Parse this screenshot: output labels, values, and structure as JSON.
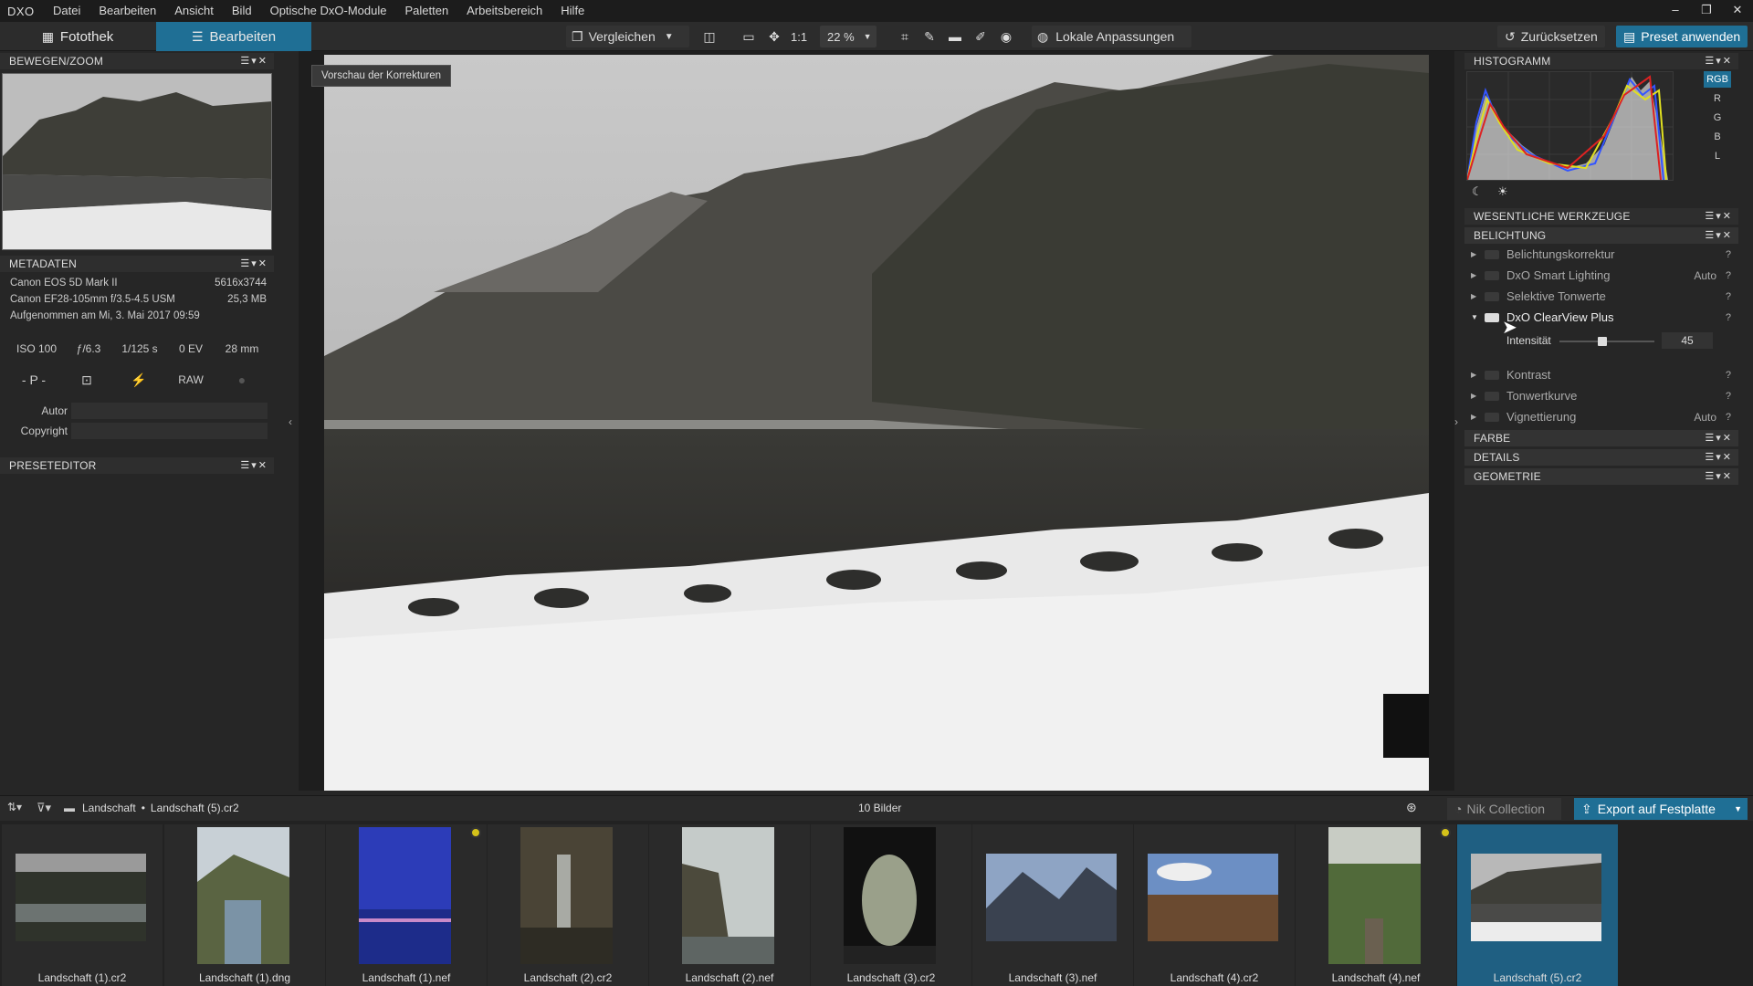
{
  "menubar": {
    "logo": "DXO",
    "items": [
      "Datei",
      "Bearbeiten",
      "Ansicht",
      "Bild",
      "Optische DxO-Module",
      "Paletten",
      "Arbeitsbereich",
      "Hilfe"
    ],
    "win_min": "–",
    "win_max": "❐",
    "win_close": "✕"
  },
  "toolbar": {
    "mode_library": "Fotothek",
    "mode_edit": "Bearbeiten",
    "compare": "Vergleichen",
    "one_to_one": "1:1",
    "zoom": "22 %",
    "local": "Lokale Anpassungen",
    "reset": "Zurücksetzen",
    "preset": "Preset anwenden"
  },
  "left": {
    "move_zoom_title": "BEWEGEN/ZOOM",
    "metadata_title": "METADATEN",
    "camera": "Canon EOS 5D Mark II",
    "resolution": "5616x3744",
    "lens": "Canon EF28-105mm f/3.5-4.5 USM",
    "filesize": "25,3 MB",
    "taken": "Aufgenommen am Mi, 3. Mai 2017 09:59",
    "iso": "ISO 100",
    "aperture": "ƒ/6.3",
    "shutter": "1/125 s",
    "ev": "0 EV",
    "focal": "28 mm",
    "mode": "- P -",
    "raw": "RAW",
    "author_label": "Autor",
    "copyright_label": "Copyright",
    "preset_title": "PRESETEDITOR"
  },
  "viewer": {
    "tooltip": "Vorschau der Korrekturen"
  },
  "right": {
    "histogram_title": "HISTOGRAMM",
    "channels": [
      "RGB",
      "R",
      "G",
      "B",
      "L"
    ],
    "essential_title": "WESENTLICHE WERKZEUGE",
    "exposure_title": "BELICHTUNG",
    "tools": [
      {
        "label": "Belichtungskorrektur",
        "extra": ""
      },
      {
        "label": "DxO Smart Lighting",
        "extra": "Auto"
      },
      {
        "label": "Selektive Tonwerte",
        "extra": ""
      },
      {
        "label": "DxO ClearView Plus",
        "extra": ""
      },
      {
        "label": "Kontrast",
        "extra": ""
      },
      {
        "label": "Tonwertkurve",
        "extra": ""
      },
      {
        "label": "Vignettierung",
        "extra": "Auto"
      }
    ],
    "intensity_label": "Intensität",
    "intensity_value": "45",
    "intensity_fraction": 0.45,
    "color_title": "FARBE",
    "details_title": "DETAILS",
    "geometry_title": "GEOMETRIE",
    "help": "?"
  },
  "filmbar": {
    "path_folder": "Landschaft",
    "path_sep": "•",
    "path_file": "Landschaft (5).cr2",
    "count": "10 Bilder",
    "nik": "Nik Collection",
    "export": "Export auf Festplatte"
  },
  "filmstrip": [
    {
      "name": "Landschaft (1).cr2"
    },
    {
      "name": "Landschaft (1).dng"
    },
    {
      "name": "Landschaft (1).nef"
    },
    {
      "name": "Landschaft (2).cr2"
    },
    {
      "name": "Landschaft (2).nef"
    },
    {
      "name": "Landschaft (3).cr2"
    },
    {
      "name": "Landschaft (3).nef"
    },
    {
      "name": "Landschaft (4).cr2"
    },
    {
      "name": "Landschaft (4).nef"
    },
    {
      "name": "Landschaft (5).cr2"
    }
  ],
  "colors": {
    "accent": "#1f6f95",
    "badge": "#d4c21a"
  }
}
